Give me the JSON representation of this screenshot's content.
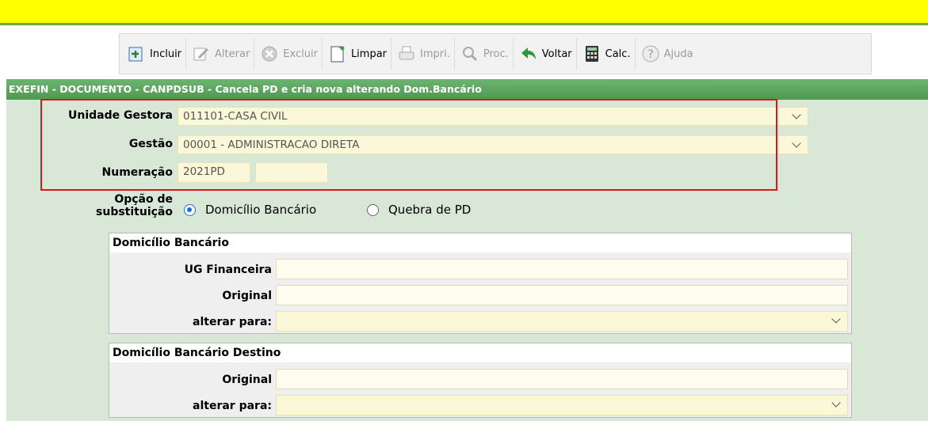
{
  "toolbar": {
    "incluir": "Incluir",
    "alterar": "Alterar",
    "excluir": "Excluir",
    "limpar": "Limpar",
    "imprimir": "Impri.",
    "procurar": "Proc.",
    "voltar": "Voltar",
    "calc": "Calc.",
    "ajuda": "Ajuda"
  },
  "title": "EXEFIN - DOCUMENTO - CANPDSUB - Cancela PD e cria nova alterando Dom.Bancário",
  "form": {
    "unidade_gestora_label": "Unidade Gestora",
    "unidade_gestora_value": "011101-CASA CIVIL",
    "gestao_label": "Gestão",
    "gestao_value": "00001 - ADMINISTRACAO DIRETA",
    "numeracao_label": "Numeração",
    "numeracao_prefix": "2021PD",
    "numeracao_number": "",
    "opcao_label_1": "Opção de",
    "opcao_label_2": "substituição",
    "opcao_domicilio": "Domicílio Bancário",
    "opcao_quebra": "Quebra de PD"
  },
  "domicilio": {
    "header": "Domicílio Bancário",
    "ug_label": "UG Financeira",
    "ug_value": "",
    "original_label": "Original",
    "original_value": "",
    "alterar_label": "alterar para:",
    "alterar_value": ""
  },
  "destino": {
    "header": "Domicílio Bancário Destino",
    "original_label": "Original",
    "original_value": "",
    "alterar_label": "alterar para:",
    "alterar_value": ""
  },
  "colors": {
    "topbar": "#ffff00",
    "titlebar": "#56a059",
    "content": "#d8e7d6",
    "field": "#fbf8d9",
    "highlight": "#e0141c",
    "radio": "#1f6fd1"
  }
}
